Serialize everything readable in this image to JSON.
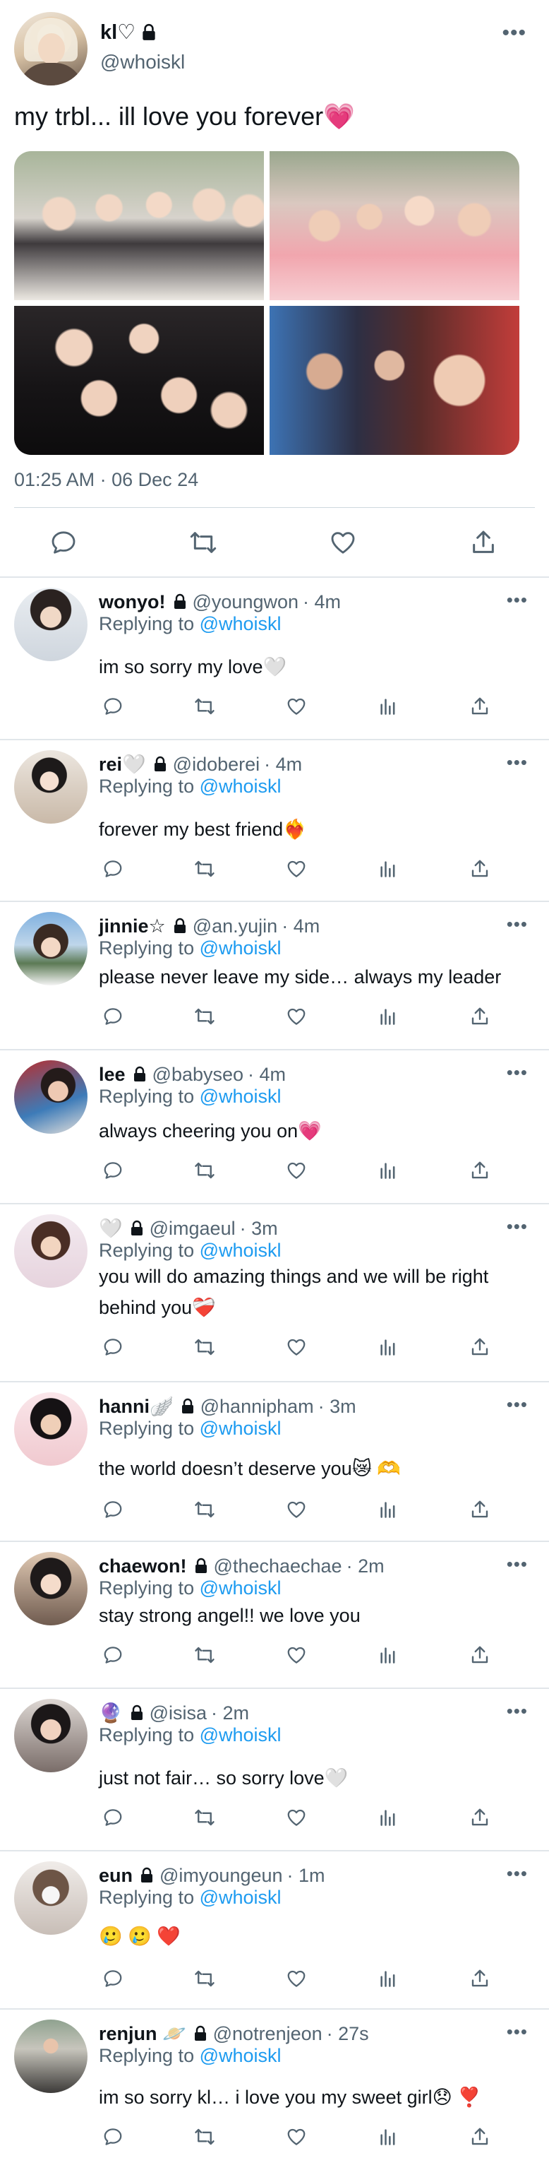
{
  "tweet": {
    "name": "kl♡",
    "handle": "@whoiskl",
    "text": "my trbl... ill love you forever💗",
    "timestamp": "01:25 AM · 06 Dec 24",
    "more": "•••",
    "photo_count": 4
  },
  "replying_label": "Replying to",
  "replying_target": "@whoiskl",
  "replies": [
    {
      "name": "wonyo!",
      "handle": "@youngwon",
      "time": "· 4m",
      "text": "im so sorry my love🤍"
    },
    {
      "name": "rei🤍",
      "handle": "@idoberei",
      "time": "· 4m",
      "text": "forever my best friend❤️‍🔥"
    },
    {
      "name": "jinnie☆",
      "handle": "@an.yujin",
      "time": "· 4m",
      "text": "please never leave my side… always my leader"
    },
    {
      "name": "lee",
      "handle": "@babyseo",
      "time": "· 4m",
      "text": "always cheering you on💗"
    },
    {
      "name": "🤍",
      "handle": "@imgaeul",
      "time": "· 3m",
      "text": "you will do amazing things and we will be right behind you❤️‍🩹"
    },
    {
      "name": "hanni🪽",
      "handle": "@hannipham",
      "time": "· 3m",
      "text": "the world doesn’t deserve you😿 🫶"
    },
    {
      "name": "chaewon!",
      "handle": "@thechaechae",
      "time": "· 2m",
      "text": "stay strong angel!! we love you"
    },
    {
      "name": "🔮",
      "handle": "@isisa",
      "time": "· 2m",
      "text": "just not fair… so sorry love🤍"
    },
    {
      "name": "eun",
      "handle": "@imyoungeun",
      "time": "· 1m",
      "text": "🥲 🥲 ❤️"
    },
    {
      "name": "renjun 🪐",
      "handle": "@notrenjeon",
      "time": "· 27s",
      "text": "im so sorry kl… i love you my sweet girl😞 ❣️"
    }
  ],
  "colors": {
    "text": "#0f1419",
    "secondary": "#536471",
    "link": "#1d9bf0",
    "divider": "#e1e6ea"
  },
  "icons": [
    "reply-icon",
    "retweet-icon",
    "like-icon",
    "views-icon",
    "share-icon",
    "lock-icon",
    "more-icon"
  ]
}
